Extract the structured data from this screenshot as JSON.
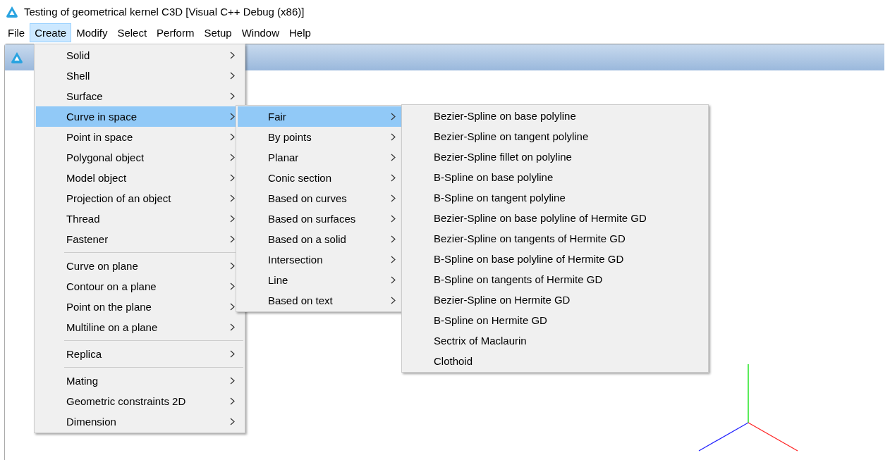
{
  "window": {
    "title": "Testing of geometrical kernel C3D [Visual C++ Debug (x86)]"
  },
  "menu_bar": [
    {
      "label": "File",
      "selected": false
    },
    {
      "label": "Create",
      "selected": true
    },
    {
      "label": "Modify",
      "selected": false
    },
    {
      "label": "Select",
      "selected": false
    },
    {
      "label": "Perform",
      "selected": false
    },
    {
      "label": "Setup",
      "selected": false
    },
    {
      "label": "Window",
      "selected": false
    },
    {
      "label": "Help",
      "selected": false
    }
  ],
  "menus": [
    {
      "items": [
        {
          "kind": "item",
          "label": "Solid",
          "selected": false,
          "has_submenu": true
        },
        {
          "kind": "item",
          "label": "Shell",
          "selected": false,
          "has_submenu": true
        },
        {
          "kind": "item",
          "label": "Surface",
          "selected": false,
          "has_submenu": true
        },
        {
          "kind": "item",
          "label": "Curve in space",
          "selected": true,
          "has_submenu": true
        },
        {
          "kind": "item",
          "label": "Point in space",
          "selected": false,
          "has_submenu": true
        },
        {
          "kind": "item",
          "label": "Polygonal object",
          "selected": false,
          "has_submenu": true
        },
        {
          "kind": "item",
          "label": "Model object",
          "selected": false,
          "has_submenu": true
        },
        {
          "kind": "item",
          "label": "Projection of an object",
          "selected": false,
          "has_submenu": true
        },
        {
          "kind": "item",
          "label": "Thread",
          "selected": false,
          "has_submenu": true
        },
        {
          "kind": "item",
          "label": "Fastener",
          "selected": false,
          "has_submenu": true
        },
        {
          "kind": "separator"
        },
        {
          "kind": "item",
          "label": "Curve on plane",
          "selected": false,
          "has_submenu": true
        },
        {
          "kind": "item",
          "label": "Contour on a plane",
          "selected": false,
          "has_submenu": true
        },
        {
          "kind": "item",
          "label": "Point on the plane",
          "selected": false,
          "has_submenu": true
        },
        {
          "kind": "item",
          "label": "Multiline on a plane",
          "selected": false,
          "has_submenu": true
        },
        {
          "kind": "separator"
        },
        {
          "kind": "item",
          "label": "Replica",
          "selected": false,
          "has_submenu": true
        },
        {
          "kind": "separator"
        },
        {
          "kind": "item",
          "label": "Mating",
          "selected": false,
          "has_submenu": true
        },
        {
          "kind": "item",
          "label": "Geometric constraints 2D",
          "selected": false,
          "has_submenu": true
        },
        {
          "kind": "item",
          "label": "Dimension",
          "selected": false,
          "has_submenu": true
        }
      ]
    },
    {
      "items": [
        {
          "kind": "item",
          "label": "Fair",
          "selected": true,
          "has_submenu": true
        },
        {
          "kind": "item",
          "label": "By points",
          "selected": false,
          "has_submenu": true
        },
        {
          "kind": "item",
          "label": "Planar",
          "selected": false,
          "has_submenu": true
        },
        {
          "kind": "item",
          "label": "Conic section",
          "selected": false,
          "has_submenu": true
        },
        {
          "kind": "item",
          "label": "Based on curves",
          "selected": false,
          "has_submenu": true
        },
        {
          "kind": "item",
          "label": "Based on surfaces",
          "selected": false,
          "has_submenu": true
        },
        {
          "kind": "item",
          "label": "Based on a solid",
          "selected": false,
          "has_submenu": true
        },
        {
          "kind": "item",
          "label": "Intersection",
          "selected": false,
          "has_submenu": true
        },
        {
          "kind": "item",
          "label": "Line",
          "selected": false,
          "has_submenu": true
        },
        {
          "kind": "item",
          "label": "Based on text",
          "selected": false,
          "has_submenu": true
        }
      ]
    },
    {
      "items": [
        {
          "kind": "item",
          "label": "Bezier-Spline on base polyline",
          "selected": false,
          "has_submenu": false
        },
        {
          "kind": "item",
          "label": "Bezier-Spline on tangent polyline",
          "selected": false,
          "has_submenu": false
        },
        {
          "kind": "item",
          "label": "Bezier-Spline fillet on polyline",
          "selected": false,
          "has_submenu": false
        },
        {
          "kind": "item",
          "label": "B-Spline on base polyline",
          "selected": false,
          "has_submenu": false
        },
        {
          "kind": "item",
          "label": "B-Spline on tangent polyline",
          "selected": false,
          "has_submenu": false
        },
        {
          "kind": "item",
          "label": "Bezier-Spline on base polyline of Hermite GD",
          "selected": false,
          "has_submenu": false
        },
        {
          "kind": "item",
          "label": "Bezier-Spline on tangents of Hermite GD",
          "selected": false,
          "has_submenu": false
        },
        {
          "kind": "item",
          "label": "B-Spline on base polyline of Hermite GD",
          "selected": false,
          "has_submenu": false
        },
        {
          "kind": "item",
          "label": "B-Spline on tangents of Hermite GD",
          "selected": false,
          "has_submenu": false
        },
        {
          "kind": "item",
          "label": "Bezier-Spline on Hermite GD",
          "selected": false,
          "has_submenu": false
        },
        {
          "kind": "item",
          "label": "B-Spline on Hermite GD",
          "selected": false,
          "has_submenu": false
        },
        {
          "kind": "item",
          "label": "Sectrix of Maclaurin",
          "selected": false,
          "has_submenu": false
        },
        {
          "kind": "item",
          "label": "Clothoid",
          "selected": false,
          "has_submenu": false
        }
      ]
    }
  ]
}
